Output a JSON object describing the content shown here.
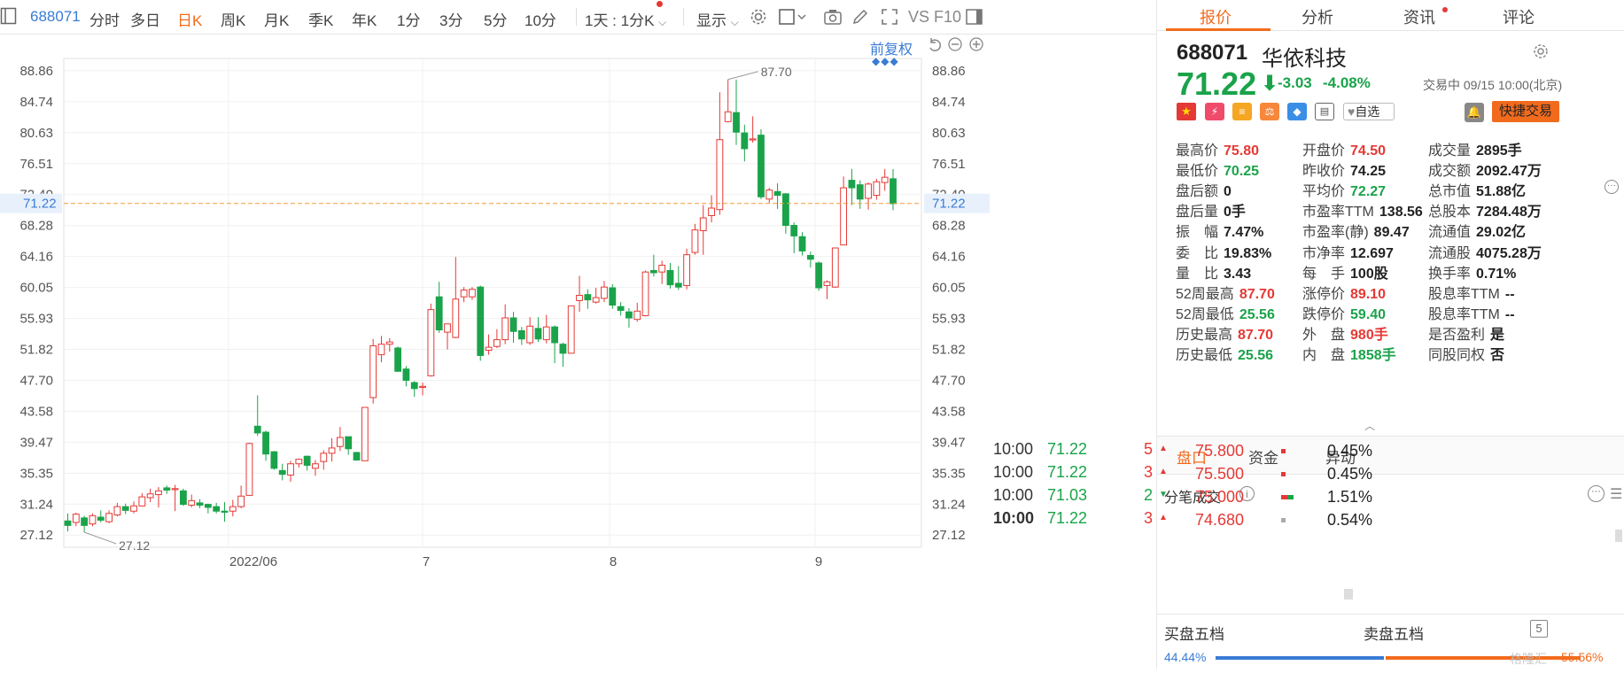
{
  "toolbar": {
    "symbol": "688071",
    "periods": [
      "分时",
      "多日",
      "日K",
      "周K",
      "月K",
      "季K",
      "年K",
      "1分",
      "3分",
      "5分",
      "10分"
    ],
    "active_period": "日K",
    "interval_select": "1天 : 1分K",
    "display_label": "显示",
    "vs_label": "VS",
    "f10_label": "F10"
  },
  "chart": {
    "fuquan_label": "前复权",
    "current_price_label": "71.22",
    "high_marker": "87.70",
    "low_marker": "27.12",
    "y_ticks": [
      "88.86",
      "84.74",
      "80.63",
      "76.51",
      "72.40",
      "68.28",
      "64.16",
      "60.05",
      "55.93",
      "51.82",
      "47.70",
      "43.58",
      "39.47",
      "35.35",
      "31.24",
      "27.12"
    ],
    "x_labels": [
      "2022/06",
      "7",
      "8",
      "9"
    ],
    "colors": {
      "up": "#e53935",
      "down": "#1aa34a",
      "ref_line": "#f39c38"
    }
  },
  "chart_data": {
    "type": "candlestick",
    "ylim": [
      25.5,
      90.5
    ],
    "candles": [
      [
        29.0,
        28.4,
        30.0,
        27.6
      ],
      [
        28.8,
        29.9,
        30.1,
        28.3
      ],
      [
        29.4,
        28.4,
        29.7,
        27.5
      ],
      [
        28.6,
        29.7,
        30.0,
        28.3
      ],
      [
        29.5,
        29.1,
        30.4,
        28.8
      ],
      [
        28.9,
        30.0,
        30.4,
        28.7
      ],
      [
        29.8,
        30.9,
        31.4,
        29.6
      ],
      [
        30.9,
        30.4,
        31.3,
        29.9
      ],
      [
        30.3,
        31.0,
        31.6,
        30.0
      ],
      [
        31.0,
        32.2,
        32.7,
        30.9
      ],
      [
        32.1,
        32.6,
        33.3,
        31.5
      ],
      [
        32.5,
        33.0,
        33.5,
        30.8
      ],
      [
        33.4,
        33.1,
        33.7,
        32.6
      ],
      [
        33.2,
        33.3,
        33.8,
        30.3
      ],
      [
        33.0,
        31.2,
        33.3,
        31.0
      ],
      [
        31.1,
        31.7,
        32.5,
        30.8
      ],
      [
        31.4,
        31.1,
        31.9,
        30.7
      ],
      [
        31.2,
        30.8,
        31.3,
        30.0
      ],
      [
        30.9,
        30.3,
        31.4,
        30.0
      ],
      [
        30.3,
        30.2,
        31.5,
        28.9
      ],
      [
        30.3,
        30.9,
        31.8,
        29.6
      ],
      [
        30.9,
        32.3,
        33.7,
        30.7
      ],
      [
        32.4,
        39.3,
        39.4,
        32.4
      ],
      [
        41.6,
        40.7,
        45.7,
        40.3
      ],
      [
        40.8,
        37.9,
        41.0,
        37.0
      ],
      [
        38.2,
        36.0,
        38.3,
        35.8
      ],
      [
        35.7,
        35.2,
        36.6,
        34.4
      ],
      [
        35.1,
        36.6,
        37.0,
        34.2
      ],
      [
        36.6,
        37.2,
        37.3,
        36.1
      ],
      [
        37.6,
        36.4,
        37.7,
        35.7
      ],
      [
        36.0,
        36.6,
        37.1,
        35.0
      ],
      [
        36.9,
        38.0,
        38.4,
        35.8
      ],
      [
        38.0,
        38.7,
        40.0,
        36.9
      ],
      [
        38.9,
        40.1,
        41.5,
        38.3
      ],
      [
        40.2,
        38.6,
        40.2,
        37.8
      ],
      [
        38.1,
        37.1,
        38.2,
        37.0
      ],
      [
        37.0,
        44.1,
        44.1,
        37.0
      ],
      [
        45.4,
        52.3,
        53.2,
        44.6
      ],
      [
        51.1,
        52.5,
        53.6,
        50.1
      ],
      [
        52.5,
        52.8,
        53.3,
        51.5
      ],
      [
        52.0,
        48.9,
        52.2,
        48.8
      ],
      [
        49.2,
        47.7,
        49.6,
        46.9
      ],
      [
        47.4,
        46.6,
        47.6,
        45.5
      ],
      [
        46.8,
        46.9,
        47.4,
        45.7
      ],
      [
        48.3,
        57.1,
        57.9,
        48.2
      ],
      [
        58.8,
        54.4,
        60.8,
        54.0
      ],
      [
        54.1,
        55.2,
        55.2,
        51.8
      ],
      [
        53.4,
        58.5,
        64.1,
        53.3
      ],
      [
        58.8,
        59.7,
        60.1,
        58.1
      ],
      [
        58.8,
        59.8,
        60.1,
        58.4
      ],
      [
        60.1,
        51.0,
        60.3,
        50.3
      ],
      [
        51.7,
        52.1,
        53.8,
        51.1
      ],
      [
        52.2,
        53.1,
        54.5,
        52.0
      ],
      [
        53.1,
        56.0,
        57.8,
        52.5
      ],
      [
        56.0,
        54.2,
        56.8,
        52.7
      ],
      [
        54.3,
        53.2,
        54.8,
        52.4
      ],
      [
        52.7,
        54.9,
        56.1,
        52.4
      ],
      [
        54.6,
        53.2,
        56.1,
        52.8
      ],
      [
        53.1,
        54.8,
        56.4,
        52.6
      ],
      [
        54.8,
        52.7,
        55.0,
        50.0
      ],
      [
        52.5,
        51.3,
        52.7,
        49.5
      ],
      [
        51.3,
        57.6,
        57.6,
        51.3
      ],
      [
        58.3,
        59.0,
        61.6,
        56.8
      ],
      [
        59.1,
        58.4,
        59.8,
        57.2
      ],
      [
        58.1,
        58.7,
        60.0,
        57.9
      ],
      [
        58.6,
        60.1,
        60.9,
        58.1
      ],
      [
        60.0,
        57.7,
        60.5,
        57.2
      ],
      [
        57.5,
        57.0,
        58.1,
        56.3
      ],
      [
        56.8,
        56.0,
        57.3,
        54.7
      ],
      [
        55.8,
        56.9,
        58.0,
        55.5
      ],
      [
        56.3,
        62.1,
        62.3,
        56.2
      ],
      [
        62.3,
        62.0,
        64.4,
        61.5
      ],
      [
        62.1,
        63.0,
        63.6,
        60.5
      ],
      [
        62.3,
        60.4,
        63.3,
        59.9
      ],
      [
        60.6,
        60.1,
        62.9,
        59.7
      ],
      [
        60.3,
        64.4,
        65.2,
        59.8
      ],
      [
        64.7,
        67.7,
        68.5,
        64.4
      ],
      [
        67.6,
        69.3,
        71.0,
        64.4
      ],
      [
        69.6,
        70.6,
        72.3,
        68.7
      ],
      [
        70.4,
        79.7,
        86.0,
        69.7
      ],
      [
        82.1,
        83.4,
        87.7,
        82.0
      ],
      [
        83.3,
        80.7,
        87.7,
        79.0
      ],
      [
        80.6,
        78.5,
        81.7,
        76.8
      ],
      [
        79.8,
        79.8,
        82.8,
        79.3
      ],
      [
        80.3,
        72.1,
        81.1,
        71.8
      ],
      [
        71.8,
        73.0,
        73.3,
        71.3
      ],
      [
        72.8,
        72.3,
        73.9,
        70.5
      ],
      [
        72.5,
        68.3,
        72.6,
        67.2
      ],
      [
        68.3,
        66.9,
        68.7,
        64.6
      ],
      [
        66.8,
        64.9,
        67.4,
        64.3
      ],
      [
        64.3,
        63.8,
        64.8,
        62.7
      ],
      [
        63.3,
        60.0,
        63.5,
        59.6
      ],
      [
        60.3,
        60.8,
        61.0,
        58.5
      ],
      [
        60.1,
        65.3,
        65.3,
        60.0
      ],
      [
        65.7,
        73.3,
        74.8,
        65.7
      ],
      [
        74.3,
        73.3,
        75.8,
        71.0
      ],
      [
        73.7,
        71.8,
        74.3,
        70.5
      ],
      [
        71.9,
        73.8,
        74.0,
        70.4
      ],
      [
        72.3,
        74.1,
        74.5,
        71.7
      ],
      [
        74.0,
        74.7,
        75.8,
        72.9
      ],
      [
        74.5,
        71.2,
        75.8,
        70.3
      ]
    ]
  },
  "panel": {
    "tabs": [
      "报价",
      "分析",
      "资讯",
      "评论"
    ],
    "active_tab": "报价",
    "code": "688071",
    "name": "华依科技",
    "price": "71.22",
    "change": "-3.03",
    "change_pct": "-4.08%",
    "status": "交易中 09/15 10:00(北京)",
    "watch_label": "自选",
    "quick_trade": "快捷交易",
    "stats": [
      [
        [
          "最高价",
          "75.80",
          "red"
        ],
        [
          "开盘价",
          "74.50",
          "red"
        ],
        [
          "成交量",
          "2895手",
          ""
        ]
      ],
      [
        [
          "最低价",
          "70.25",
          "green"
        ],
        [
          "昨收价",
          "74.25",
          ""
        ],
        [
          "成交额",
          "2092.47万",
          ""
        ]
      ],
      [
        [
          "盘后额",
          "0",
          ""
        ],
        [
          "平均价",
          "72.27",
          "green"
        ],
        [
          "总市值",
          "51.88亿",
          ""
        ]
      ],
      [
        [
          "盘后量",
          "0手",
          ""
        ],
        [
          "市盈率TTM",
          "138.56",
          ""
        ],
        [
          "总股本",
          "7284.48万",
          ""
        ]
      ],
      [
        [
          "振　幅",
          "7.47%",
          ""
        ],
        [
          "市盈率(静)",
          "89.47",
          ""
        ],
        [
          "流通值",
          "29.02亿",
          ""
        ]
      ],
      [
        [
          "委　比",
          "19.83%",
          ""
        ],
        [
          "市净率",
          "12.697",
          ""
        ],
        [
          "流通股",
          "4075.28万",
          ""
        ]
      ],
      [
        [
          "量　比",
          "3.43",
          ""
        ],
        [
          "每　手",
          "100股",
          ""
        ],
        [
          "换手率",
          "0.71%",
          ""
        ]
      ],
      [
        [
          "52周最高",
          "87.70",
          "red"
        ],
        [
          "涨停价",
          "89.10",
          "red"
        ],
        [
          "股息率TTM",
          "--",
          ""
        ]
      ],
      [
        [
          "52周最低",
          "25.56",
          "green"
        ],
        [
          "跌停价",
          "59.40",
          "green"
        ],
        [
          "股息率TTM",
          "--",
          ""
        ]
      ],
      [
        [
          "历史最高",
          "87.70",
          "red"
        ],
        [
          "外　盘",
          "980手",
          "red"
        ],
        [
          "是否盈利",
          "是",
          ""
        ]
      ],
      [
        [
          "历史最低",
          "25.56",
          "green"
        ],
        [
          "内　盘",
          "1858手",
          "green"
        ],
        [
          "同股同权",
          "否",
          ""
        ]
      ]
    ],
    "subtabs": [
      "盘口",
      "资金",
      "异动"
    ],
    "active_subtab": "盘口",
    "ticks_title": "分笔成交",
    "ticks": [
      [
        "10:00",
        "71.22",
        "5",
        "up"
      ],
      [
        "10:00",
        "71.22",
        "3",
        "up"
      ],
      [
        "10:00",
        "71.03",
        "2",
        "down"
      ],
      [
        "10:00",
        "71.22",
        "3",
        "up"
      ]
    ],
    "price_dist": [
      [
        "75.800",
        "0.45%"
      ],
      [
        "75.500",
        "0.45%"
      ],
      [
        "75.000",
        "1.51%"
      ],
      [
        "74.680",
        "0.54%"
      ]
    ],
    "buy_label": "买盘五档",
    "sell_label": "卖盘五档",
    "buy_pct": "44.44%",
    "sell_pct": "55.56%",
    "depth_badge": "5",
    "watermark": "格隆汇"
  }
}
